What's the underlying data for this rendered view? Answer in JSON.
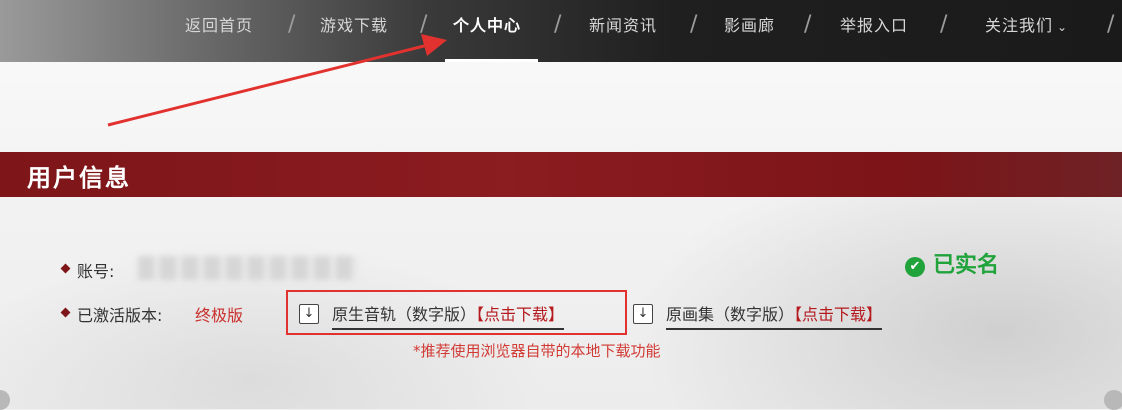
{
  "nav": {
    "items": [
      {
        "label": "返回首页"
      },
      {
        "label": "游戏下载"
      },
      {
        "label": "个人中心"
      },
      {
        "label": "新闻资讯"
      },
      {
        "label": "影画廊"
      },
      {
        "label": "举报入口"
      },
      {
        "label": "关注我们"
      }
    ],
    "separator": "/",
    "active_index": 2,
    "dropdown_icon": "chevron-down-icon"
  },
  "section": {
    "title": "用户信息"
  },
  "account": {
    "label": "账号:"
  },
  "verification": {
    "status": "已实名",
    "icon": "check-circle-icon",
    "color": "#1fa33a"
  },
  "edition": {
    "label": "已激活版本:",
    "value": "终极版"
  },
  "downloads": [
    {
      "name": "原生音轨（数字版）",
      "action": "【点击下载】",
      "icon": "download-icon"
    },
    {
      "name": "原画集（数字版）",
      "action": "【点击下载】",
      "icon": "download-icon"
    }
  ],
  "note": "*推荐使用浏览器自带的本地下载功能",
  "colors": {
    "accent": "#7d1519",
    "highlight": "#e2322f",
    "link_red": "#b51a1f"
  }
}
